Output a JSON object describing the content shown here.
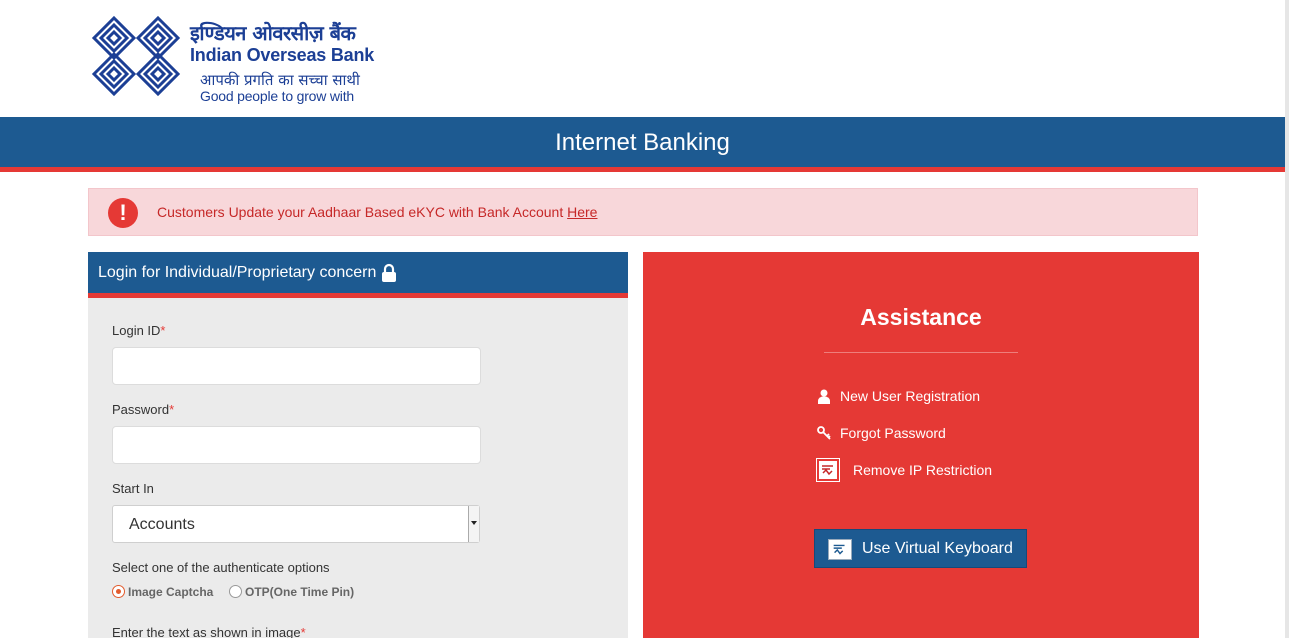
{
  "header": {
    "logo_hindi": "इण्डियन ओवरसीज़ बैंक",
    "logo_english": "Indian Overseas Bank",
    "tagline_hindi": "आपकी प्रगति का सच्चा साथी",
    "tagline_english": "Good people to grow with",
    "brand_color": "#1c3f95"
  },
  "titlebar": {
    "title": "Internet Banking",
    "bar_color": "#1d5a91",
    "accent_color": "#e53935"
  },
  "alert": {
    "icon": "exclamation-icon",
    "text": "Customers Update your Aadhaar Based eKYC with Bank Account ",
    "link": "Here"
  },
  "login": {
    "title": "Login for Individual/Proprietary concern",
    "title_icon": "lock-icon",
    "login_id_label": "Login ID",
    "password_label": "Password",
    "required_mark": "*",
    "login_id_value": "",
    "password_value": "",
    "start_in_label": "Start In",
    "start_in_value": "Accounts",
    "auth_label": "Select one of the authenticate options",
    "auth_options": [
      "Image Captcha",
      "OTP(One Time Pin)"
    ],
    "auth_selected": "Image Captcha",
    "captcha_label": "Enter the text as shown in image"
  },
  "assistance": {
    "title": "Assistance",
    "links": [
      "New User Registration",
      "Forgot Password",
      "Remove IP Restriction"
    ],
    "link_icons": [
      "user-icon",
      "key-icon",
      "ip-restriction-icon"
    ],
    "virtual_keyboard_label": "Use Virtual Keyboard",
    "panel_color": "#e53935"
  }
}
